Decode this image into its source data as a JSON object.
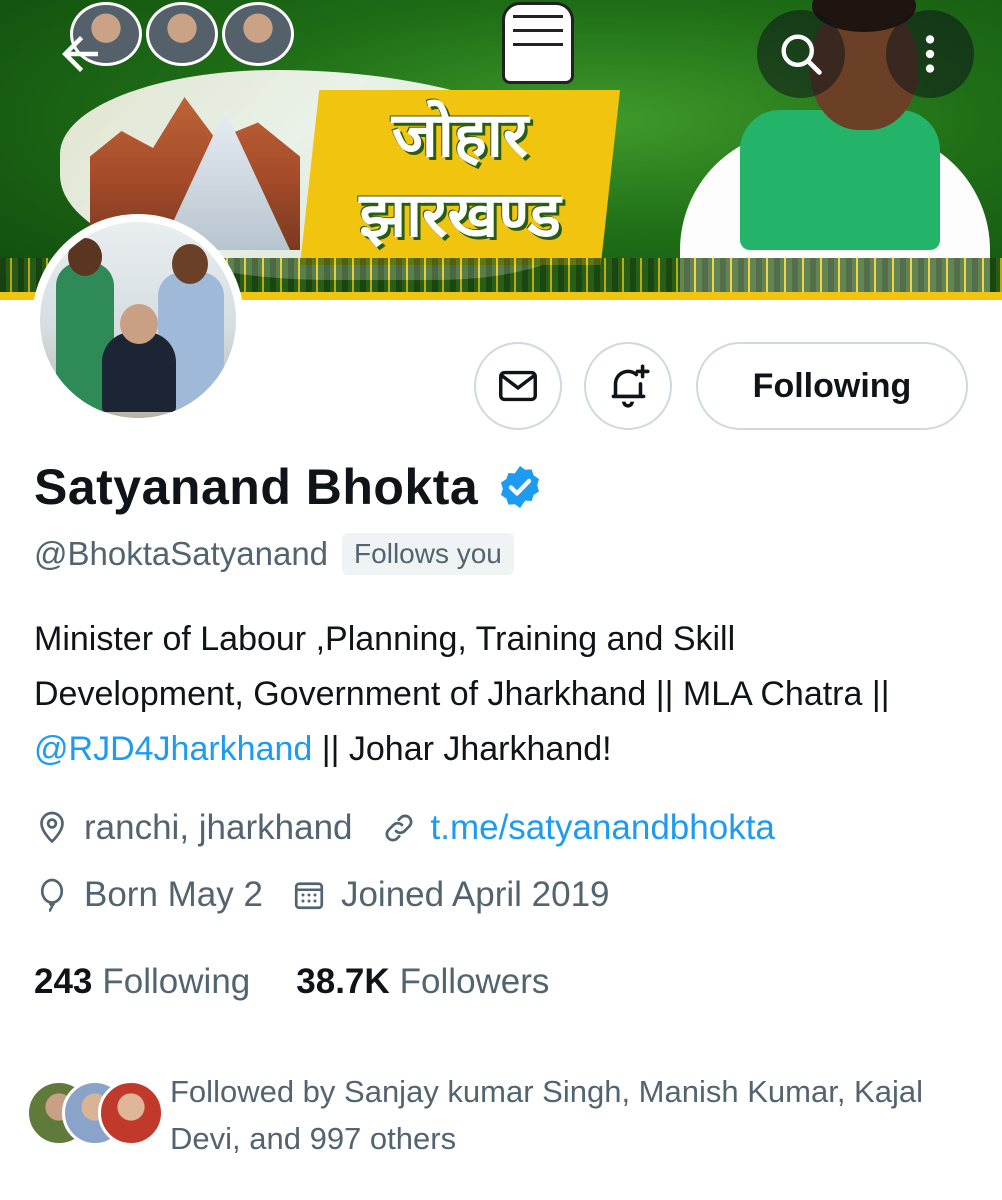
{
  "banner": {
    "slogan_line1": "जोहार",
    "slogan_line2": "झारखण्ड"
  },
  "top_bar": {
    "back_icon": "arrow-left-icon",
    "search_icon": "search-icon",
    "more_icon": "more-vertical-icon"
  },
  "actions": {
    "message_icon": "mail-icon",
    "notify_icon": "bell-plus-icon",
    "following_label": "Following"
  },
  "profile": {
    "name": "Satyanand Bhokta",
    "verified": true,
    "handle": "@BhoktaSatyanand",
    "follows_you": "Follows you",
    "bio_part1": "Minister of Labour ,Planning, Training and Skill Development, Government of Jharkhand || MLA Chatra || ",
    "bio_mention": "@RJD4Jharkhand",
    "bio_part2": " || Johar Jharkhand!",
    "location": "ranchi, jharkhand",
    "website": "t.me/satyanandbhokta",
    "birthday": "Born May 2",
    "joined": "Joined April 2019"
  },
  "stats": {
    "following_count": "243",
    "following_label": "Following",
    "followers_count": "38.7K",
    "followers_label": "Followers"
  },
  "followed_by": {
    "text": "Followed by Sanjay kumar Singh, Manish Kumar, Kajal Devi, and 997 others"
  },
  "colors": {
    "accent": "#1d9bf0",
    "text_primary": "#0f1419",
    "text_secondary": "#536471",
    "banner_green": "#1f6e17",
    "banner_yellow": "#f1c40f"
  }
}
